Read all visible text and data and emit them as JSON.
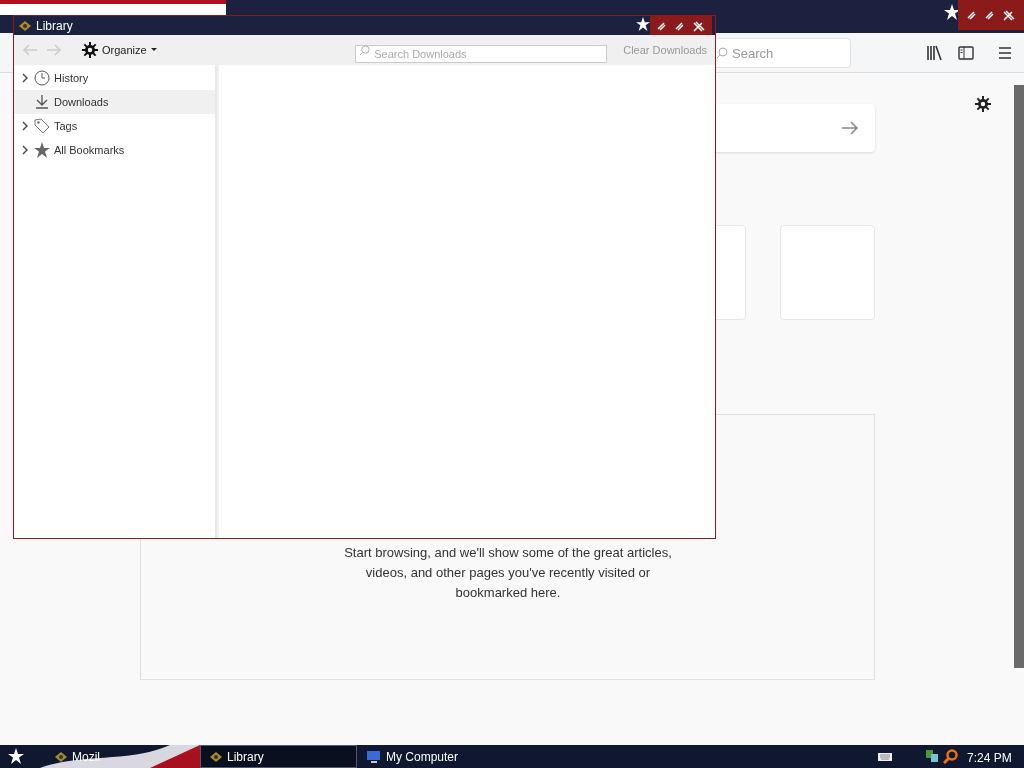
{
  "browser": {
    "search": {
      "placeholder": "Search"
    },
    "highlights_message": "Start browsing, and we'll show some of the great articles, videos, and other pages you've recently visited or bookmarked here."
  },
  "library": {
    "title": "Library",
    "organize": "Organize",
    "search": {
      "placeholder": "Search Downloads"
    },
    "clear_button": "Clear Downloads",
    "sidebar": [
      {
        "label": "History",
        "kind": "clock",
        "expandable": true,
        "selected": false
      },
      {
        "label": "Downloads",
        "kind": "download",
        "expandable": false,
        "selected": true
      },
      {
        "label": "Tags",
        "kind": "tag",
        "expandable": true,
        "selected": false
      },
      {
        "label": "All Bookmarks",
        "kind": "star",
        "expandable": true,
        "selected": false
      }
    ]
  },
  "taskbar": {
    "buttons": [
      {
        "label": "Mozil",
        "kind": "app",
        "selected": false
      },
      {
        "label": "Library",
        "kind": "app",
        "selected": true
      },
      {
        "label": "My Computer",
        "kind": "computer",
        "selected": false
      }
    ],
    "clock": "7:24 PM"
  }
}
